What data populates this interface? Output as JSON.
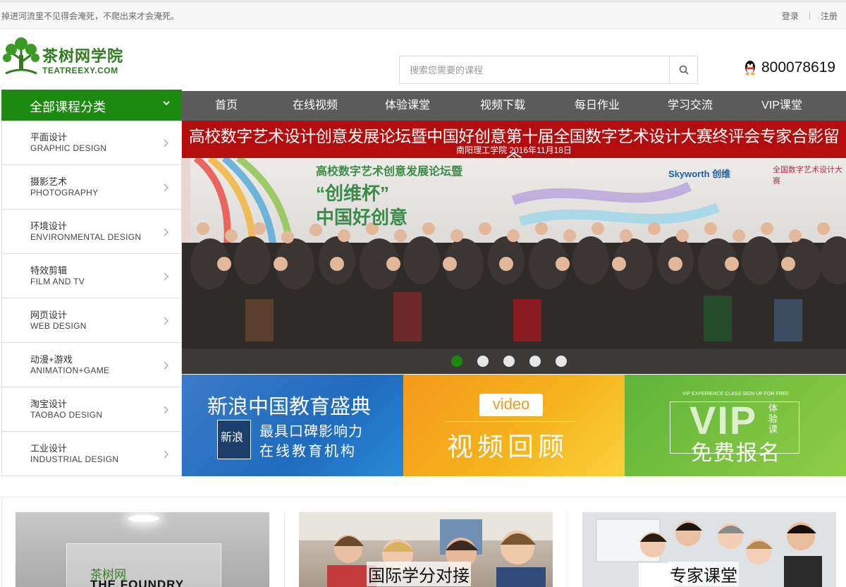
{
  "topbar": {
    "motto": "掉进河流里不见得会淹死，不爬出来才会淹死。",
    "login": "登录",
    "separator": "|",
    "register": "注册"
  },
  "header": {
    "site_name": "茶树网学院",
    "domain": "TEATREEXY.COM",
    "search_placeholder": "搜索您需要的课程",
    "qq_number": "800078619",
    "brand_color": "#1c8a10"
  },
  "categories": {
    "title": "全部课程分类",
    "items": [
      {
        "cn": "平面设计",
        "en": "GRAPHIC DESIGN"
      },
      {
        "cn": "摄影艺术",
        "en": "PHOTOGRAPHY"
      },
      {
        "cn": "环境设计",
        "en": "ENVIRONMENTAL DESIGN"
      },
      {
        "cn": "特效剪辑",
        "en": "FILM AND TV"
      },
      {
        "cn": "网页设计",
        "en": "WEB DESIGN"
      },
      {
        "cn": "动漫+游戏",
        "en": "ANIMATION+GAME"
      },
      {
        "cn": "淘宝设计",
        "en": "TAOBAO DESIGN"
      },
      {
        "cn": "工业设计",
        "en": "INDUSTRIAL DESIGN"
      }
    ]
  },
  "nav": {
    "items": [
      "首页",
      "在线视频",
      "体验课堂",
      "视频下载",
      "每日作业",
      "学习交流",
      "VIP课堂"
    ]
  },
  "banner": {
    "title": "高校数字艺术设计创意发展论坛暨中国好创意第十届全国数字艺术设计大赛终评会专家合影留念",
    "subtitle": "南阳理工学院    2016年11月18日",
    "photo_text1": "高校数字艺术创意发展论坛暨",
    "photo_text2": "“创维杯”",
    "photo_text3": "中国好创意",
    "photo_brand1": "Skyworth 创维",
    "photo_brand2": "全国数字艺术设计大赛",
    "active_slide": 1,
    "slide_count": 5
  },
  "promos": {
    "p1": {
      "title": "新浪中国教育盛典",
      "line1": "最具口碑影响力",
      "line2": "在线教育机构",
      "logo_text": "新浪"
    },
    "p2": {
      "badge": "video",
      "title": "视频回顾"
    },
    "p3": {
      "small": "VIP EXPERIENCE CLASS SIGN UP FOR FREE",
      "vip": "VIP",
      "vertical": "体验课",
      "title": "免费报名"
    }
  },
  "cards": {
    "c1": {
      "line1": "茶树网",
      "line2": "THE FOUNDRY"
    },
    "c2": {
      "caption": "国际学分对接"
    },
    "c3": {
      "caption": "专家课堂"
    }
  }
}
